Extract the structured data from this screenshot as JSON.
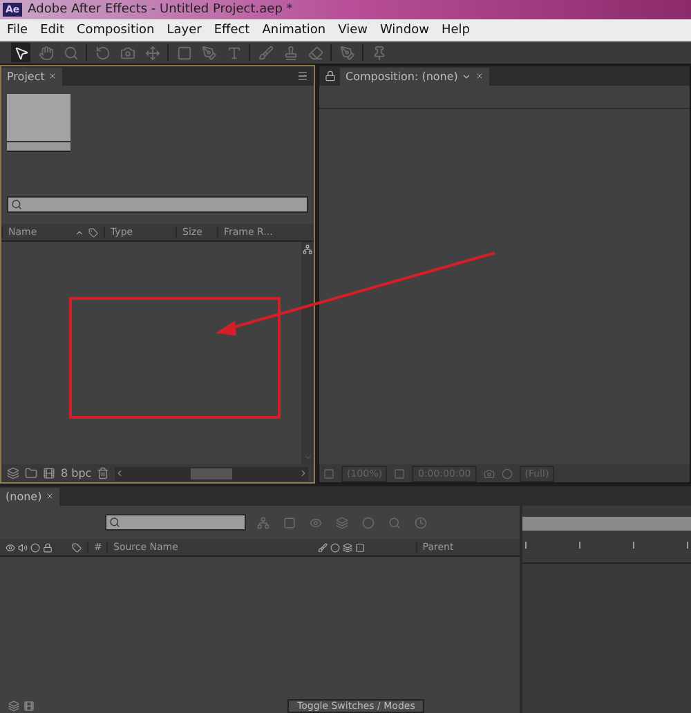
{
  "window": {
    "app_badge": "Ae",
    "title": "Adobe After Effects - Untitled Project.aep *"
  },
  "menu": [
    "File",
    "Edit",
    "Composition",
    "Layer",
    "Effect",
    "Animation",
    "View",
    "Window",
    "Help"
  ],
  "project_panel": {
    "tab": "Project",
    "columns": [
      "Name",
      "Type",
      "Size",
      "Frame R..."
    ],
    "bit_depth": "8 bpc"
  },
  "composition_panel": {
    "tab": "Composition: (none)",
    "zoom": "(100%)",
    "timecode": "0:00:00:00",
    "resolution": "(Full)"
  },
  "timeline_panel": {
    "tab": "(none)",
    "columns": [
      "#",
      "Source Name",
      "Parent"
    ],
    "toggle_button": "Toggle Switches / Modes"
  }
}
